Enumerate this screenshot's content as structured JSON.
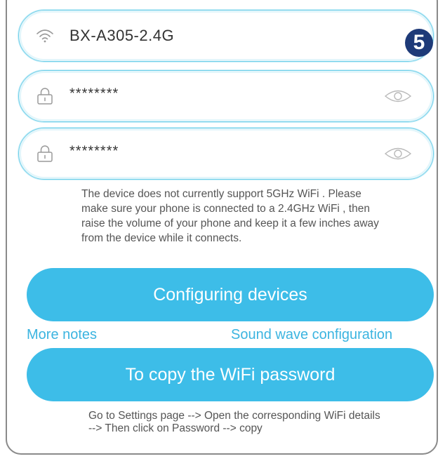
{
  "wifi_field": {
    "icon": "wifi-icon",
    "ssid": "BX-A305-2.4G"
  },
  "step_badge": "5",
  "password_field": {
    "icon": "lock-icon",
    "value": "********",
    "toggle_icon": "eye-icon"
  },
  "confirm_field": {
    "icon": "lock-icon",
    "value": "********",
    "toggle_icon": "eye-icon"
  },
  "notice": "The device does not currently support 5GHz WiFi . Please make sure your phone is connected to a 2.4GHz WiFi , then raise the volume of your phone and keep it a few inches away from the device while it connects.",
  "configure_button": "Configuring devices",
  "links": {
    "more_notes": "More notes",
    "sound_wave": "Sound wave configuration"
  },
  "copy_button": "To copy the WiFi password",
  "copy_hint": "Go to Settings page --> Open the corresponding WiFi details --> Then click on Password --> copy",
  "colors": {
    "accent": "#3dbde8",
    "field_border": "#6fcfe9",
    "badge": "#1e3a78",
    "link": "#3bb4e0"
  }
}
